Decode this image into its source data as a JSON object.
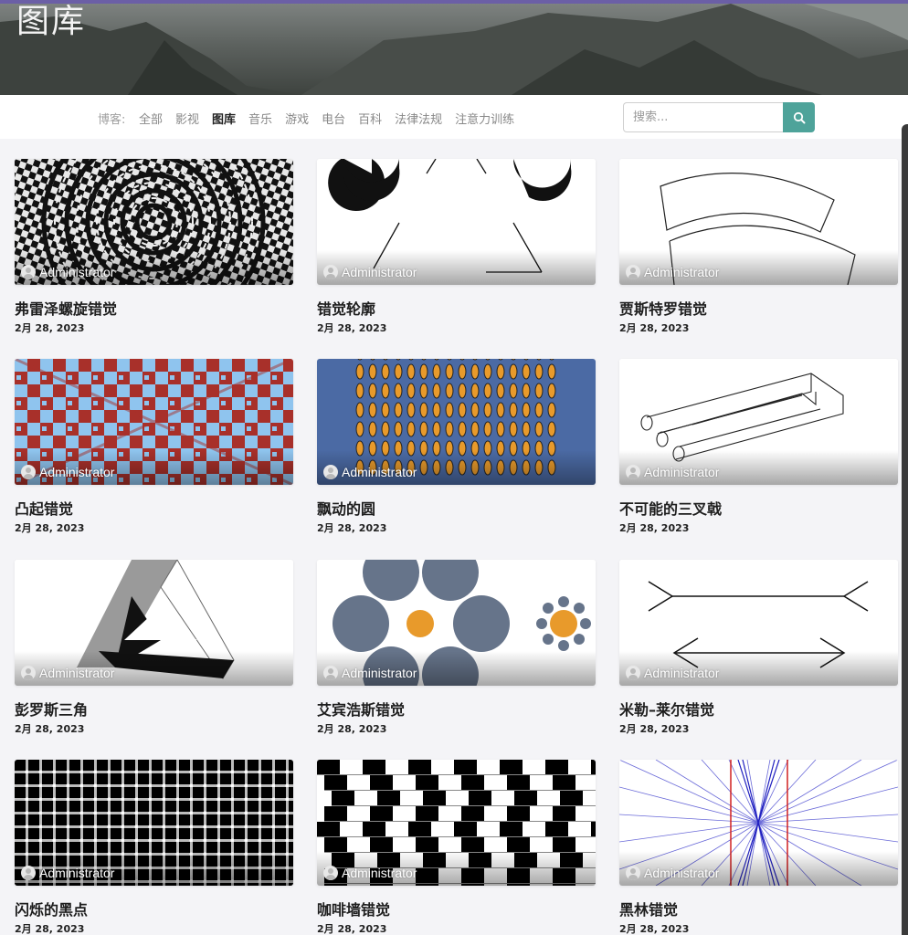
{
  "colors": {
    "accent": "#4ea39a",
    "top_bar": "#6b5fa6"
  },
  "hero": {
    "title": "图库"
  },
  "nav": {
    "prefix": "博客:",
    "items": [
      {
        "label": "全部",
        "active": false
      },
      {
        "label": "影视",
        "active": false
      },
      {
        "label": "图库",
        "active": true
      },
      {
        "label": "音乐",
        "active": false
      },
      {
        "label": "游戏",
        "active": false
      },
      {
        "label": "电台",
        "active": false
      },
      {
        "label": "百科",
        "active": false
      },
      {
        "label": "法律法规",
        "active": false
      },
      {
        "label": "注意力训练",
        "active": false
      }
    ]
  },
  "search": {
    "placeholder": "搜索...",
    "icon": "search-icon"
  },
  "posts": [
    {
      "title": "弗雷泽螺旋错觉",
      "author": "Administrator",
      "date": "2月 28, 2023"
    },
    {
      "title": "错觉轮廓",
      "author": "Administrator",
      "date": "2月 28, 2023"
    },
    {
      "title": "贾斯特罗错觉",
      "author": "Administrator",
      "date": "2月 28, 2023"
    },
    {
      "title": "凸起错觉",
      "author": "Administrator",
      "date": "2月 28, 2023"
    },
    {
      "title": "飘动的圆",
      "author": "Administrator",
      "date": "2月 28, 2023"
    },
    {
      "title": "不可能的三叉戟",
      "author": "Administrator",
      "date": "2月 28, 2023"
    },
    {
      "title": "彭罗斯三角",
      "author": "Administrator",
      "date": "2月 28, 2023"
    },
    {
      "title": "艾宾浩斯错觉",
      "author": "Administrator",
      "date": "2月 28, 2023"
    },
    {
      "title": "米勒–莱尔错觉",
      "author": "Administrator",
      "date": "2月 28, 2023"
    },
    {
      "title": "闪烁的黑点",
      "author": "Administrator",
      "date": "2月 28, 2023"
    },
    {
      "title": "咖啡墙错觉",
      "author": "Administrator",
      "date": "2月 28, 2023"
    },
    {
      "title": "黑林错觉",
      "author": "Administrator",
      "date": "2月 28, 2023"
    }
  ]
}
